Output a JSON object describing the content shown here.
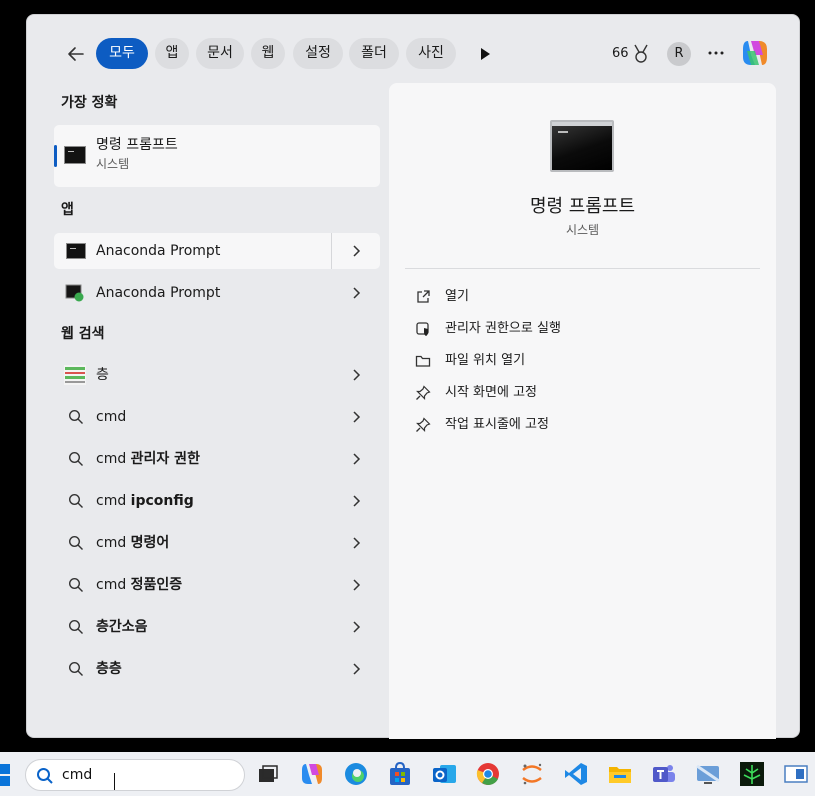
{
  "filters": {
    "chips": [
      "모두",
      "앱",
      "문서",
      "웹",
      "설정",
      "폴더",
      "사진"
    ],
    "active": "모두"
  },
  "rewards": {
    "points": "66"
  },
  "account": {
    "initial": "R"
  },
  "best_match": {
    "heading": "가장 정확",
    "title": "명령 프롬프트",
    "subtitle": "시스템"
  },
  "apps": {
    "heading": "앱",
    "items": [
      "Anaconda Prompt",
      "Anaconda Prompt"
    ]
  },
  "web": {
    "heading": "웹 검색",
    "items": [
      {
        "plain": "층",
        "bold": ""
      },
      {
        "plain": "cmd",
        "bold": ""
      },
      {
        "plain": "cmd ",
        "bold": "관리자 권한"
      },
      {
        "plain": "cmd ",
        "bold": "ipconfig"
      },
      {
        "plain": "cmd ",
        "bold": "명령어"
      },
      {
        "plain": "cmd ",
        "bold": "정품인증"
      },
      {
        "plain": "",
        "bold": "층간소음"
      },
      {
        "plain": "",
        "bold": "층층"
      }
    ]
  },
  "preview": {
    "title": "명령 프롬프트",
    "subtitle": "시스템",
    "actions": [
      {
        "label": "열기",
        "icon": "open-external-icon"
      },
      {
        "label": "관리자 권한으로 실행",
        "icon": "shield-icon"
      },
      {
        "label": "파일 위치 열기",
        "icon": "folder-icon"
      },
      {
        "label": "시작 화면에 고정",
        "icon": "pin-icon"
      },
      {
        "label": "작업 표시줄에 고정",
        "icon": "pin-icon"
      }
    ]
  },
  "taskbar": {
    "search_value": "cmd",
    "apps": [
      "task-view-icon",
      "copilot-icon",
      "edge-icon",
      "store-icon",
      "outlook-icon",
      "chrome-icon",
      "jupyter-icon",
      "vscode-icon",
      "file-explorer-icon",
      "teams-icon",
      "remote-desktop-icon",
      "terminal-icon",
      "app-icon"
    ]
  },
  "colors": {
    "accent": "#0d5cc2",
    "panel": "#e9eaed",
    "surface": "#f7f7f8",
    "taskbar": "#eef0f4"
  }
}
